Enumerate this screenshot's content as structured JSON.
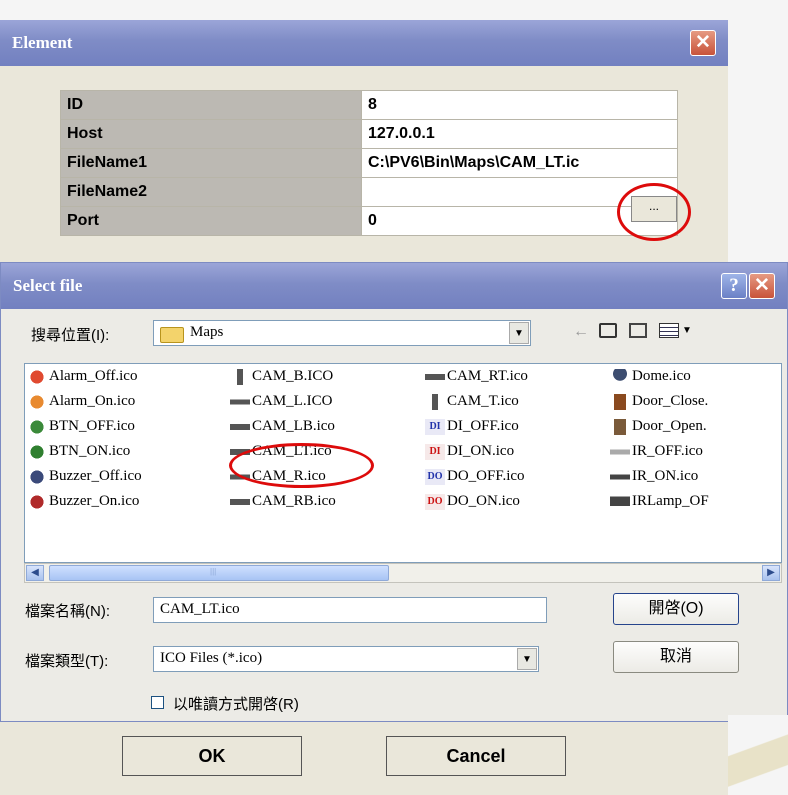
{
  "element_dialog": {
    "title": "Element",
    "close_glyph": "✕",
    "properties": [
      {
        "key": "ID",
        "value": "8"
      },
      {
        "key": "Host",
        "value": "127.0.0.1"
      },
      {
        "key": "FileName1",
        "value": "C:\\PV6\\Bin\\Maps\\CAM_LT.ic"
      },
      {
        "key": "FileName2",
        "value": ""
      },
      {
        "key": "Port",
        "value": "0"
      }
    ],
    "browse_label": "...",
    "ok_label": "OK",
    "cancel_label": "Cancel"
  },
  "select_file": {
    "title": "Select file",
    "help_glyph": "?",
    "close_glyph": "✕",
    "look_in_label": "搜尋位置(I):",
    "look_in_value": "Maps",
    "files": [
      [
        "Alarm_Off.ico",
        "Alarm_On.ico",
        "BTN_OFF.ico",
        "BTN_ON.ico",
        "Buzzer_Off.ico",
        "Buzzer_On.ico"
      ],
      [
        "CAM_B.ICO",
        "CAM_L.ICO",
        "CAM_LB.ico",
        "CAM_LT.ico",
        "CAM_R.ico",
        "CAM_RB.ico"
      ],
      [
        "CAM_RT.ico",
        "CAM_T.ico",
        "DI_OFF.ico",
        "DI_ON.ico",
        "DO_OFF.ico",
        "DO_ON.ico"
      ],
      [
        "Dome.ico",
        "Door_Close.",
        "Door_Open.",
        "IR_OFF.ico",
        "IR_ON.ico",
        "IRLamp_OF"
      ]
    ],
    "file_name_label": "檔案名稱(N):",
    "file_name_value": "CAM_LT.ico",
    "file_type_label": "檔案類型(T):",
    "file_type_value": "ICO Files (*.ico)",
    "open_label": "開啓(O)",
    "cancel_label": "取消",
    "readonly_label": "以唯讀方式開啓(R)"
  },
  "colors": {
    "annotation": "#dd0b0b",
    "title_bar": "#7f8cc6"
  }
}
